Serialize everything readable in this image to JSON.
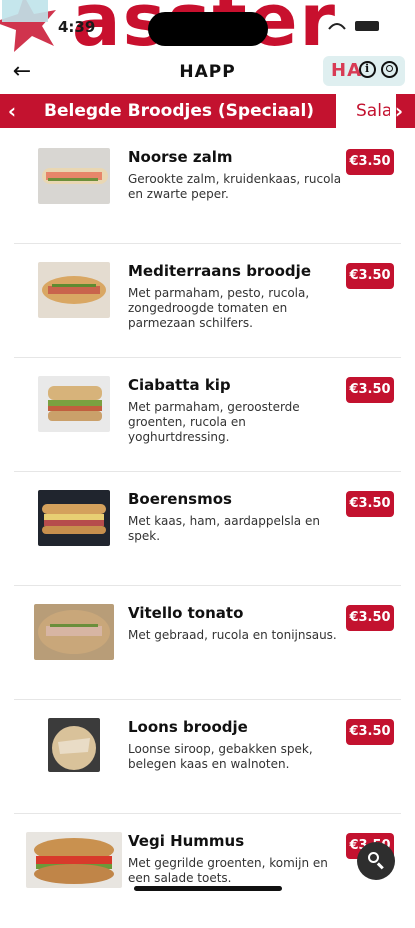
{
  "status": {
    "time": "4:39"
  },
  "header": {
    "title": "HAPP",
    "logo_text": "HA"
  },
  "banner": {
    "word": "asster"
  },
  "categories": {
    "active": "Belegde Broodjes (Speciaal)",
    "next": "Sala",
    "prev_arrow": "‹",
    "next_arrow": "›"
  },
  "icons": {
    "back": "arrow-left-icon",
    "info": "info-icon",
    "user": "user-icon",
    "search": "search-icon"
  },
  "colors": {
    "brand_red": "#c3122f",
    "fab": "#2e2e2e"
  },
  "products": [
    {
      "name": "Noorse zalm",
      "description": "Gerookte zalm, kruidenkaas, rucola en zwarte peper.",
      "price": "€3.50",
      "photo": "salmon"
    },
    {
      "name": "Mediterraans broodje",
      "description": "Met parmaham, pesto, rucola, zongedroogde tomaten en parmezaan schilfers.",
      "price": "€3.50",
      "photo": "baguette"
    },
    {
      "name": "Ciabatta kip",
      "description": "Met parmaham, geroosterde groenten, rucola en yoghurtdressing.",
      "price": "€3.50",
      "photo": "ciabatta"
    },
    {
      "name": "Boerensmos",
      "description": "Met kaas, ham, aardappelsla en spek.",
      "price": "€3.50",
      "photo": "boerensmos"
    },
    {
      "name": "Vitello tonato",
      "description": "Met gebraad, rucola en tonijnsaus.",
      "price": "€3.50",
      "photo": "vitello"
    },
    {
      "name": "Loons broodje",
      "description": "Loonse siroop, gebakken spek, belegen kaas en walnoten.",
      "price": "€3.50",
      "photo": "loons"
    },
    {
      "name": "Vegi Hummus",
      "description": "Met gegrilde groenten, komijn en een salade toets.",
      "price": "€3.50",
      "photo": "hummus"
    }
  ]
}
